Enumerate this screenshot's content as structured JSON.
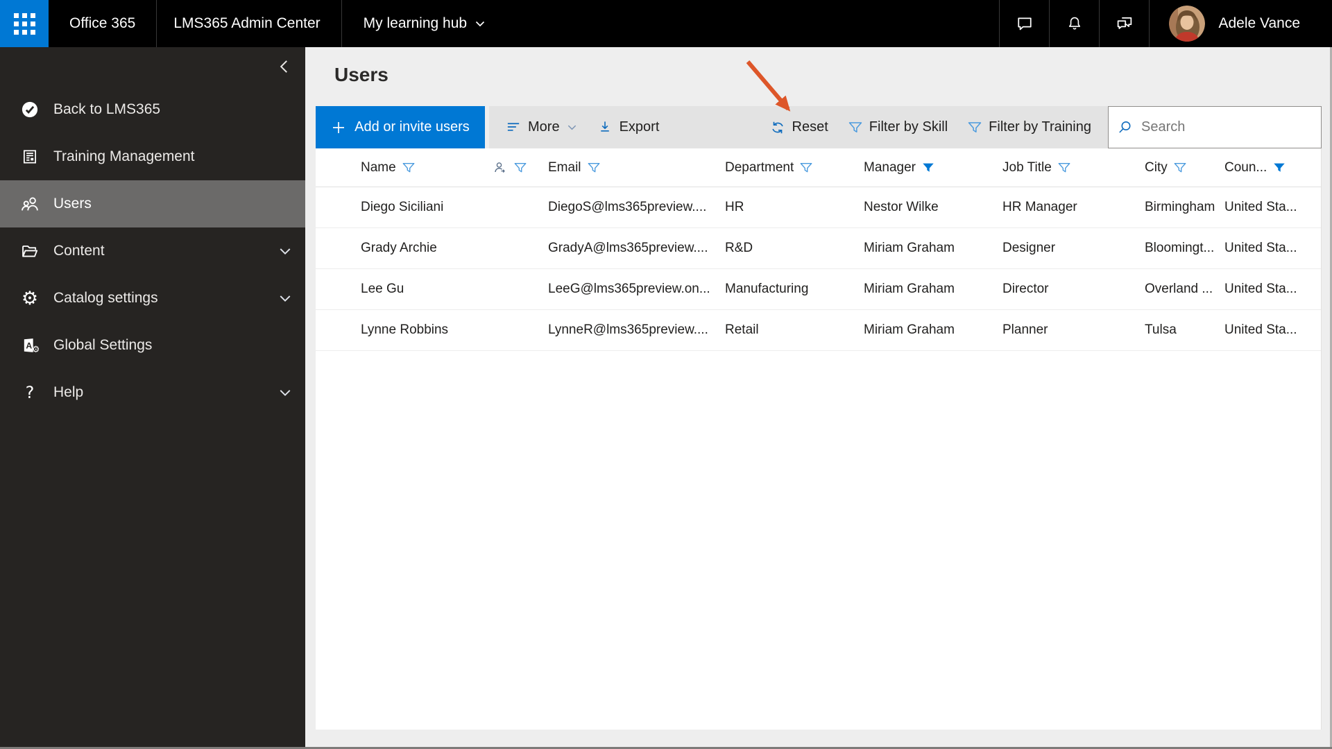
{
  "topbar": {
    "product": "Office 365",
    "app_title": "LMS365 Admin Center",
    "hub_label": "My learning hub",
    "user_name": "Adele Vance",
    "icons": [
      "app-launcher-icon",
      "chat-icon",
      "bell-icon",
      "feedback-icon",
      "avatar"
    ]
  },
  "sidebar": {
    "items": [
      {
        "label": "Back to LMS365",
        "icon": "check-circle-icon",
        "selected": false,
        "chevron": false
      },
      {
        "label": "Training Management",
        "icon": "document-icon",
        "selected": false,
        "chevron": false
      },
      {
        "label": "Users",
        "icon": "people-icon",
        "selected": true,
        "chevron": false
      },
      {
        "label": "Content",
        "icon": "folder-icon",
        "selected": false,
        "chevron": true
      },
      {
        "label": "Catalog settings",
        "icon": "gear-icon",
        "selected": false,
        "chevron": true
      },
      {
        "label": "Global Settings",
        "icon": "book-gear-icon",
        "selected": false,
        "chevron": false
      },
      {
        "label": "Help",
        "icon": "question-icon",
        "selected": false,
        "chevron": true
      }
    ],
    "gear_glyph": "⚙",
    "help_glyph": "?",
    "book_letter": "A"
  },
  "main": {
    "title": "Users",
    "toolbar": {
      "add_label": "Add or invite users",
      "add_plus": "+",
      "more_label": "More",
      "export_label": "Export",
      "reset_label": "Reset",
      "filter_skill_label": "Filter by Skill",
      "filter_training_label": "Filter by Training",
      "search_placeholder": "Search"
    },
    "table": {
      "columns": [
        {
          "label": "Name",
          "filter": "outline"
        },
        {
          "label": "",
          "icon": "person-arrow-icon",
          "filter": "outline"
        },
        {
          "label": "Email",
          "filter": "outline"
        },
        {
          "label": "Department",
          "filter": "outline"
        },
        {
          "label": "Manager",
          "filter": "filled"
        },
        {
          "label": "Job Title",
          "filter": "outline"
        },
        {
          "label": "City",
          "filter": "outline"
        },
        {
          "label": "Coun...",
          "filter": "filled"
        }
      ],
      "rows": [
        {
          "name": "Diego Siciliani",
          "email": "DiegoS@lms365preview....",
          "department": "HR",
          "manager": "Nestor Wilke",
          "job_title": "HR Manager",
          "city": "Birmingham",
          "country": "United Sta..."
        },
        {
          "name": "Grady Archie",
          "email": "GradyA@lms365preview....",
          "department": "R&D",
          "manager": "Miriam Graham",
          "job_title": "Designer",
          "city": "Bloomingt...",
          "country": "United Sta..."
        },
        {
          "name": "Lee Gu",
          "email": "LeeG@lms365preview.on...",
          "department": "Manufacturing",
          "manager": "Miriam Graham",
          "job_title": "Director",
          "city": "Overland ...",
          "country": "United Sta..."
        },
        {
          "name": "Lynne Robbins",
          "email": "LynneR@lms365preview....",
          "department": "Retail",
          "manager": "Miriam Graham",
          "job_title": "Planner",
          "city": "Tulsa",
          "country": "United Sta..."
        }
      ]
    },
    "annotation": {
      "type": "arrow",
      "points_at": "Reset",
      "color": "#dd5629"
    }
  },
  "colors": {
    "accent": "#0078d4",
    "topbar_bg": "#000000",
    "sidebar_bg": "#262422",
    "sidebar_selected": "#6b6a69",
    "main_bg": "#eeeeee",
    "toolbar_bg": "#e3e3e3",
    "filter_outline": "#4a9ade",
    "filter_filled": "#0078d4",
    "annotation_arrow": "#dd5629"
  }
}
